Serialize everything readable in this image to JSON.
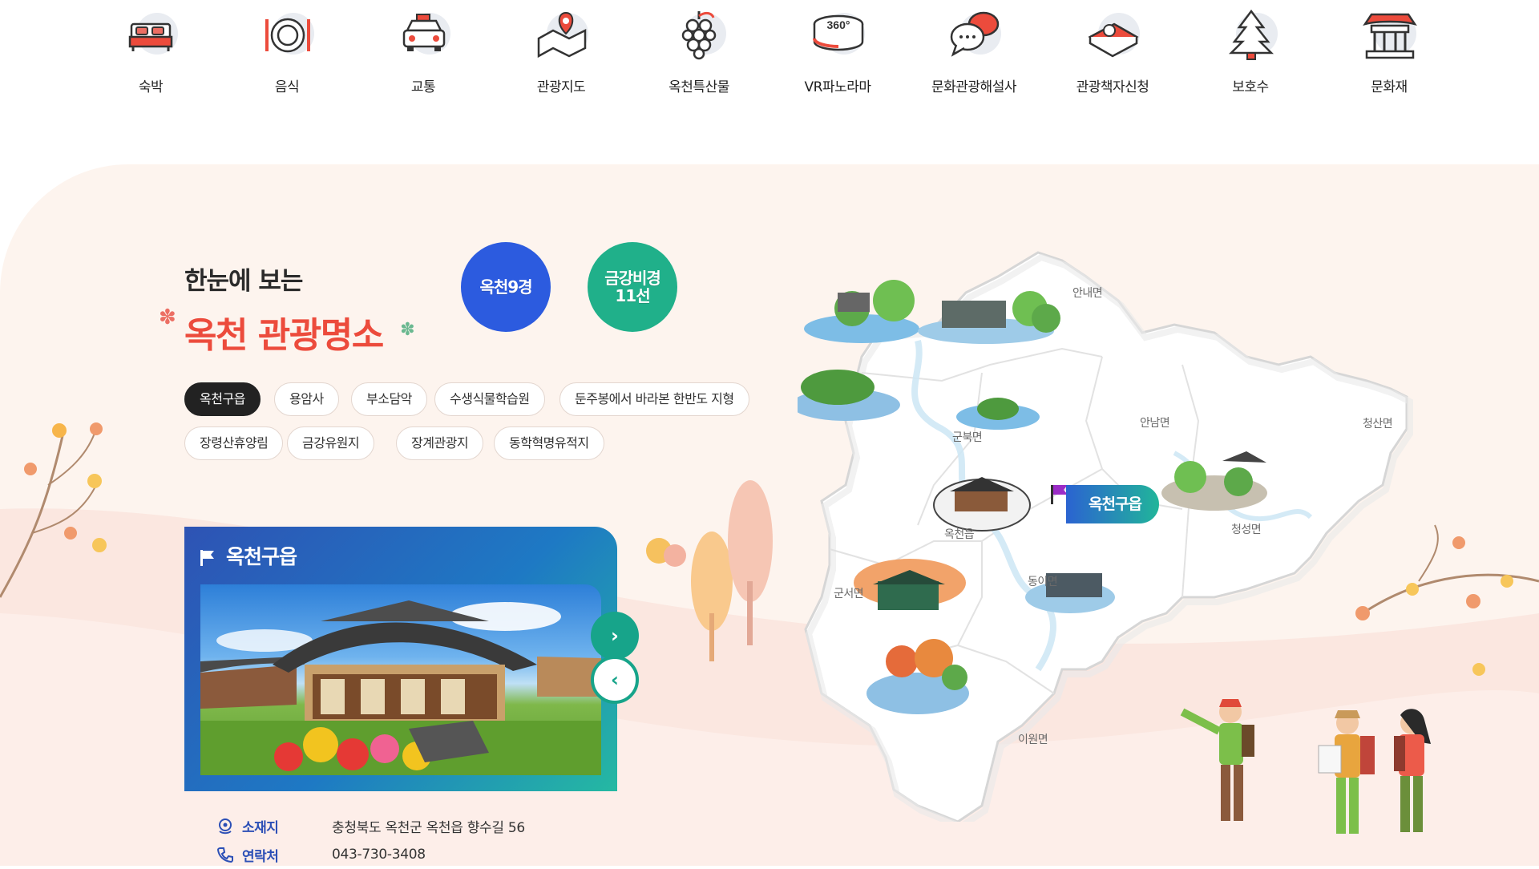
{
  "quick_menu": [
    {
      "label": "숙박",
      "icon": "bed-icon"
    },
    {
      "label": "음식",
      "icon": "dining-icon"
    },
    {
      "label": "교통",
      "icon": "taxi-icon"
    },
    {
      "label": "관광지도",
      "icon": "map-pin-icon"
    },
    {
      "label": "옥천특산물",
      "icon": "grape-icon"
    },
    {
      "label": "VR파노라마",
      "icon": "vr-360-icon"
    },
    {
      "label": "문화관광해설사",
      "icon": "chat-bubbles-icon"
    },
    {
      "label": "관광책자신청",
      "icon": "book-icon"
    },
    {
      "label": "보호수",
      "icon": "tree-icon"
    },
    {
      "label": "문화재",
      "icon": "pavilion-icon"
    }
  ],
  "tour": {
    "subtitle": "한눈에 보는",
    "title_a": "옥천",
    "title_b": "관광명소",
    "badge_9": "옥천9경",
    "badge_11_line1": "금강비경",
    "badge_11_line2": "11선",
    "tags": [
      "옥천구읍",
      "용암사",
      "부소담악",
      "수생식물학습원",
      "둔주봉에서 바라본 한반도 지형",
      "장령산휴양림",
      "금강유원지",
      "장계관광지",
      "동학혁명유적지"
    ],
    "active_tag": "옥천구읍",
    "card_title": "옥천구읍",
    "next_label": "›",
    "prev_label": "‹",
    "info": {
      "address_label": "소재지",
      "address": "충청북도 옥천군 옥천읍 향수길 56",
      "phone_label": "연락처",
      "phone": "043-730-3408"
    }
  },
  "map": {
    "regions": [
      "안내면",
      "군북면",
      "안남면",
      "청산면",
      "옥천읍",
      "청성면",
      "군서면",
      "동이면",
      "이원면"
    ],
    "highlight": "옥천구읍"
  },
  "colors": {
    "accent_red": "#ec4b3c",
    "accent_blue": "#2c5bdf",
    "accent_green": "#20b08a",
    "section_bg": "#fdf4ee"
  }
}
